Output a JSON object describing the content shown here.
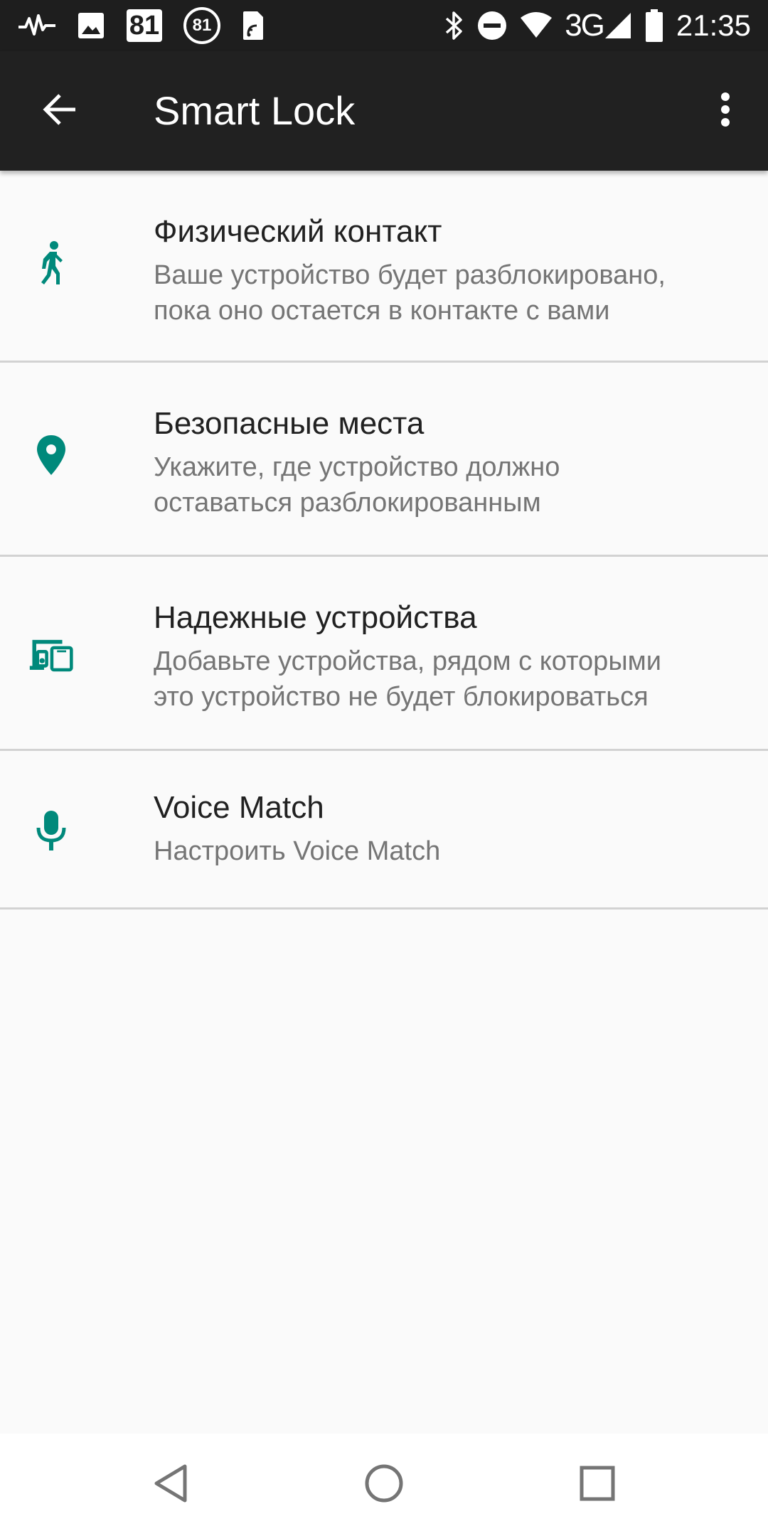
{
  "status_bar": {
    "notif_box_number": "81",
    "notif_circle_number": "81",
    "network_type": "3G",
    "time": "21:35",
    "left_icons": [
      "pulse-icon",
      "image-icon",
      "calendar-81-icon",
      "circle-81-icon",
      "sim-nfc-icon"
    ],
    "right_icons": [
      "bluetooth-icon",
      "do-not-disturb-icon",
      "wifi-icon",
      "signal-icon",
      "battery-icon"
    ]
  },
  "app_bar": {
    "title": "Smart Lock",
    "back_icon": "arrow-back-icon",
    "menu_icon": "more-vert-icon"
  },
  "items": [
    {
      "title": "Физический контакт",
      "summary_line1": "Ваше устройство будет разблокировано,",
      "summary_line2": "пока оно остается в контакте с вами",
      "icon": "walking-person-icon"
    },
    {
      "title": "Безопасные места",
      "summary_line1": "Укажите, где устройство должно",
      "summary_line2": "оставаться разблокированным",
      "icon": "location-pin-icon"
    },
    {
      "title": "Надежные устройства",
      "summary_line1": "Добавьте устройства, рядом с которыми",
      "summary_line2": "это устройство не будет блокироваться",
      "icon": "devices-icon"
    },
    {
      "title": "Voice Match",
      "summary": "Настроить Voice Match",
      "icon": "microphone-icon"
    }
  ],
  "nav_bar": {
    "back": "nav-back-icon",
    "home": "nav-home-icon",
    "recents": "nav-recents-icon"
  },
  "colors": {
    "accent": "#00897b",
    "status_bar_bg": "#1e1e1e",
    "app_bar_bg": "#212121",
    "background": "#fafafa",
    "divider": "#d2d2d2",
    "title_text": "#212121",
    "summary_text": "#757575"
  }
}
